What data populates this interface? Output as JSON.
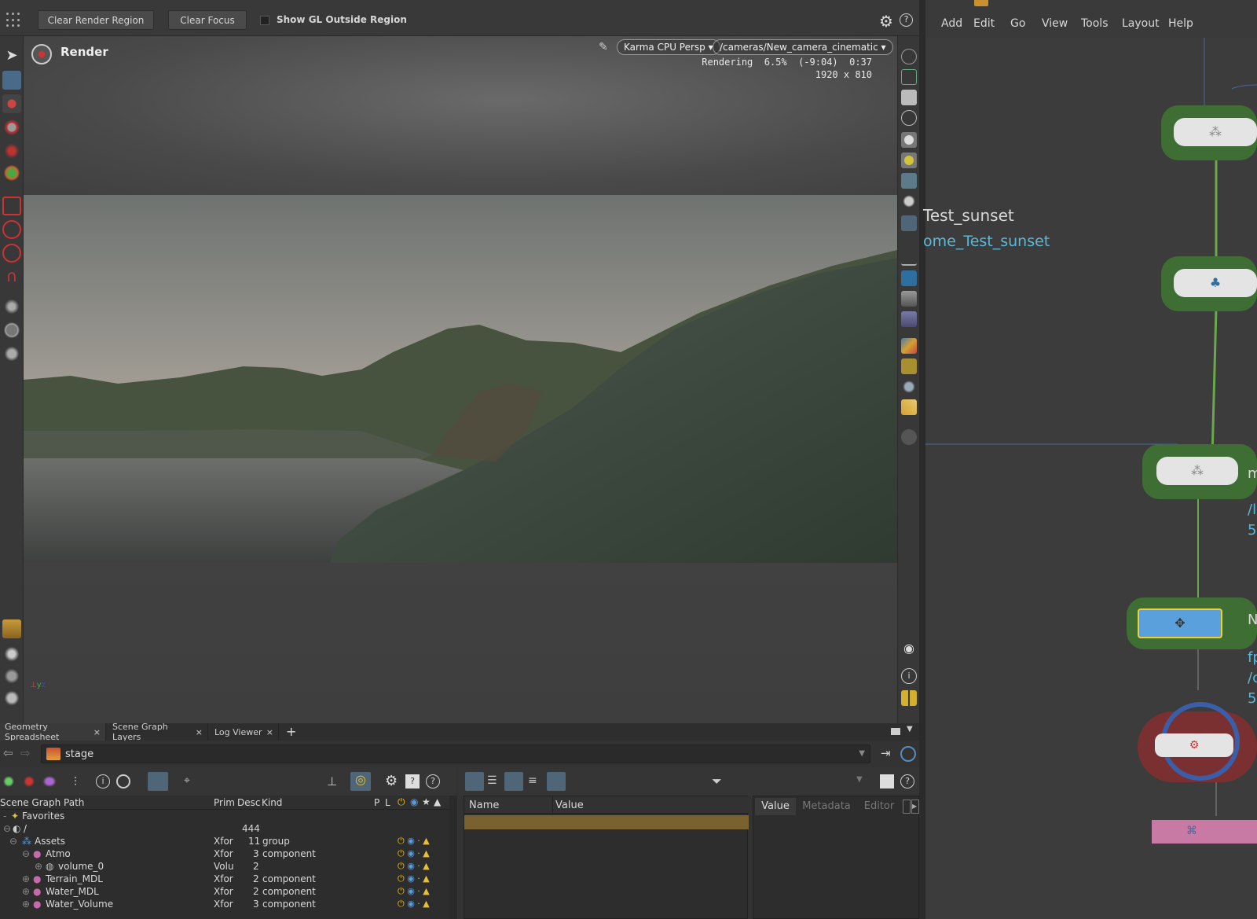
{
  "toolbar": {
    "clear_render_region": "Clear Render Region",
    "clear_focus": "Clear Focus",
    "show_gl_outside": "Show GL Outside Region"
  },
  "viewport": {
    "title": "Render",
    "renderer": "Karma CPU Persp",
    "camera": "/cameras/New_camera_cinematic",
    "status": "Rendering  6.5%  (-9:04)  0:37",
    "resolution": "1920 x 810"
  },
  "network": {
    "menu": [
      "Add",
      "Edit",
      "Go",
      "View",
      "Tools",
      "Layout",
      "Help"
    ],
    "label_title": "Test_sunset",
    "label_link": "ome_Test_sunset",
    "side_text": [
      "m",
      "/l",
      "5",
      "N",
      "fp",
      "/c",
      "5"
    ]
  },
  "bottom": {
    "tabs": [
      "Geometry Spreadsheet",
      "Scene Graph Layers",
      "Log Viewer"
    ],
    "path": "stage",
    "tree_headers": [
      "Scene Graph Path",
      "Prim",
      "Desc",
      "Kind",
      "P",
      "L"
    ],
    "rows": [
      {
        "name": "Favorites",
        "prim": "",
        "desc": "",
        "kind": ""
      },
      {
        "name": "/",
        "prim": "",
        "desc": "444",
        "kind": ""
      },
      {
        "name": "Assets",
        "prim": "Xfor",
        "desc": "11",
        "kind": "group"
      },
      {
        "name": "Atmo",
        "prim": "Xfor",
        "desc": "3",
        "kind": "component"
      },
      {
        "name": "volume_0",
        "prim": "Volu",
        "desc": "2",
        "kind": ""
      },
      {
        "name": "Terrain_MDL",
        "prim": "Xfor",
        "desc": "2",
        "kind": "component"
      },
      {
        "name": "Water_MDL",
        "prim": "Xfor",
        "desc": "2",
        "kind": "component"
      },
      {
        "name": "Water_Volume",
        "prim": "Xfor",
        "desc": "3",
        "kind": "component"
      }
    ],
    "prop_headers": [
      "Name",
      "Value"
    ],
    "value_tabs": [
      "Value",
      "Metadata",
      "Editor"
    ]
  }
}
